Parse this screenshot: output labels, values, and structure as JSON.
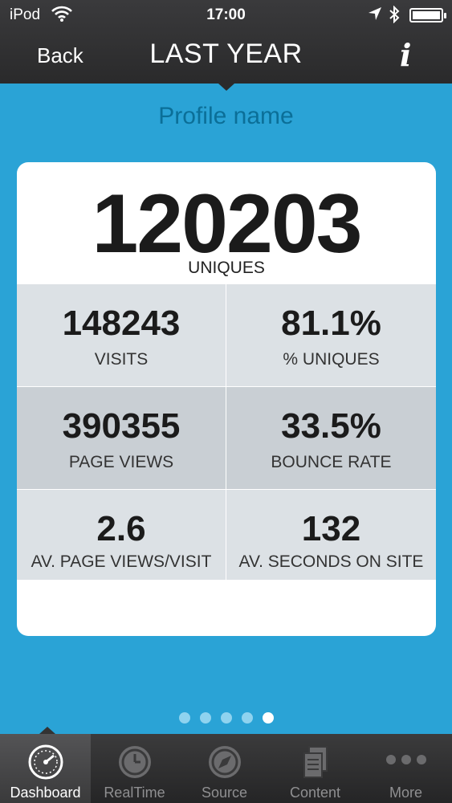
{
  "status_bar": {
    "carrier": "iPod",
    "time": "17:00"
  },
  "nav": {
    "back_label": "Back",
    "title": "LAST YEAR",
    "info_label": "i"
  },
  "profile_name": "Profile name",
  "hero": {
    "value": "120203",
    "label": "UNIQUES"
  },
  "metrics": [
    {
      "value": "148243",
      "label": "VISITS"
    },
    {
      "value": "81.1%",
      "label": "% UNIQUES"
    },
    {
      "value": "390355",
      "label": "PAGE VIEWS"
    },
    {
      "value": "33.5%",
      "label": "BOUNCE RATE"
    },
    {
      "value": "2.6",
      "label": "AV. PAGE VIEWS/VISIT"
    },
    {
      "value": "132",
      "label": "AV. SECONDS ON SITE"
    }
  ],
  "pager": {
    "count": 5,
    "active_index": 4
  },
  "tabs": [
    {
      "label": "Dashboard",
      "icon": "speedometer-icon",
      "active": true
    },
    {
      "label": "RealTime",
      "icon": "clock-icon",
      "active": false
    },
    {
      "label": "Source",
      "icon": "compass-icon",
      "active": false
    },
    {
      "label": "Content",
      "icon": "documents-icon",
      "active": false
    },
    {
      "label": "More",
      "icon": "more-dots-icon",
      "active": false
    }
  ],
  "colors": {
    "background": "#2aa3d6",
    "profile_name": "#0b6f98",
    "bar": "#2a2a2b"
  }
}
